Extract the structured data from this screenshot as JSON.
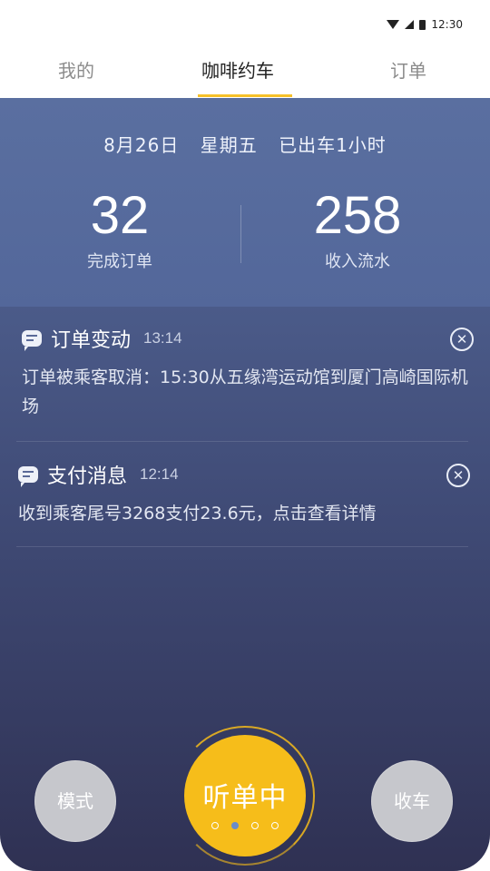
{
  "status": {
    "time": "12:30"
  },
  "tabs": [
    {
      "label": "我的"
    },
    {
      "label": "咖啡约车"
    },
    {
      "label": "订单"
    }
  ],
  "summary": {
    "date": "8月26日",
    "weekday": "星期五",
    "drive_time": "已出车1小时",
    "orders_completed": "32",
    "orders_completed_label": "完成订单",
    "income": "258",
    "income_label": "收入流水"
  },
  "messages": [
    {
      "title": "订单变动",
      "time": "13:14",
      "body": "订单被乘客取消：15:30从五缘湾运动馆到厦门高崎国际机场"
    },
    {
      "title": "支付消息",
      "time": "12:14",
      "body": "收到乘客尾号3268支付23.6元，点击查看详情"
    }
  ],
  "controls": {
    "mode_label": "模式",
    "listen_label": "听单中",
    "stop_label": "收车",
    "page_dots": 4,
    "active_dot": 1
  },
  "colors": {
    "accent": "#f6bd1a",
    "header_bg": "#5a6fa0",
    "bottom_bg": "#2f3153"
  }
}
